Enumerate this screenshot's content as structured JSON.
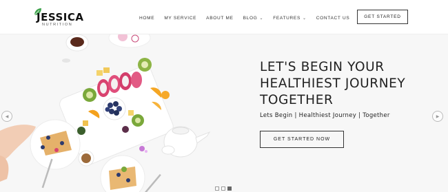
{
  "brand": {
    "name": "JESSICA",
    "tagline": "NUTRITION",
    "accent": "#3fa34d"
  },
  "nav": {
    "items": [
      {
        "label": "HOME",
        "dropdown": false
      },
      {
        "label": "MY SERVICE",
        "dropdown": false
      },
      {
        "label": "ABOUT ME",
        "dropdown": false
      },
      {
        "label": "BLOG",
        "dropdown": true
      },
      {
        "label": "FEATURES",
        "dropdown": true
      },
      {
        "label": "CONTACT US",
        "dropdown": false
      }
    ],
    "dropdown_icon": "chevron-down-icon",
    "cta_label": "GET STARTED"
  },
  "hero": {
    "title": "LET'S BEGIN YOUR HEALTHIEST JOURNEY TOGETHER",
    "subtitle": "Lets Begin | Healthiest Journey | Together",
    "cta_label": "GET STARTED NOW",
    "image": "food-platter-image",
    "prev_icon": "arrow-left-icon",
    "next_icon": "arrow-right-icon"
  },
  "slider": {
    "slides": 3,
    "active_index": 2
  }
}
